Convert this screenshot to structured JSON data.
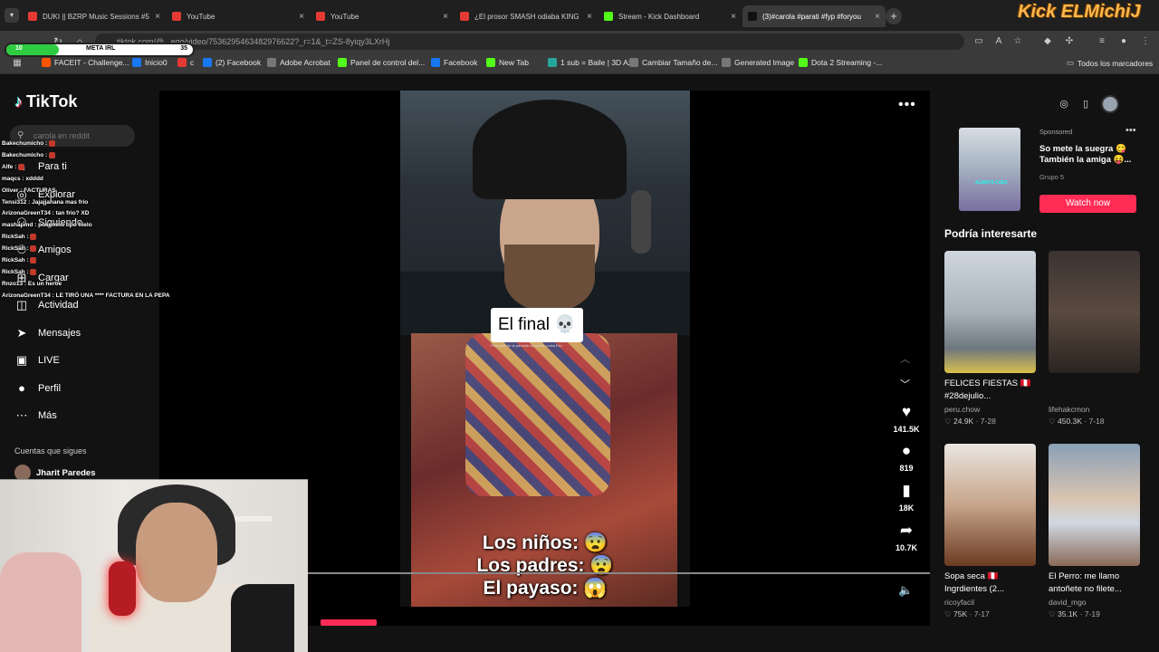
{
  "browser": {
    "tabs": [
      {
        "title": "DUKI || BZRP Music Sessions #5",
        "favicon_color": "#e53935",
        "active": false
      },
      {
        "title": "YouTube",
        "favicon_color": "#e53935",
        "active": false
      },
      {
        "title": "YouTube",
        "favicon_color": "#e53935",
        "active": false
      },
      {
        "title": "¿El prosor SMASH odiaba KING",
        "favicon_color": "#e53935",
        "active": false
      },
      {
        "title": "Stream - Kick Dashboard",
        "favicon_color": "#53fc18",
        "active": false
      },
      {
        "title": "(3)#carola #parati #fyp #foryou",
        "favicon_color": "#111111",
        "active": true
      }
    ],
    "close_glyph": "×",
    "new_tab_glyph": "+",
    "url": "tiktok.com/@...ego/video/7536295463482976622?_r=1&_t=ZS-8yiqy3LXrHj",
    "bookmarks": [
      {
        "label": "FACEIT - Challenge...",
        "color": "#ff5500"
      },
      {
        "label": "Inicio0",
        "color": "#1877f2"
      },
      {
        "label": "c",
        "color": "#e53935"
      },
      {
        "label": "(2) Facebook",
        "color": "#1877f2"
      },
      {
        "label": "Adobe Acrobat",
        "color": "#777777"
      },
      {
        "label": "Panel de control del...",
        "color": "#53fc18"
      },
      {
        "label": "Facebook",
        "color": "#1877f2"
      },
      {
        "label": "New Tab",
        "color": "#53fc18"
      },
      {
        "label": "1 sub = Baile | 3D Az...",
        "color": "#26a69a"
      },
      {
        "label": "Cambiar Tamaño de...",
        "color": "#777777"
      },
      {
        "label": "Generated Image",
        "color": "#777777"
      },
      {
        "label": "Dota 2 Streaming -...",
        "color": "#53fc18"
      }
    ],
    "all_bookmarks": "Todos los marcadores"
  },
  "overlay": {
    "brand": "Kick ELMichiJ",
    "meta_left": "10",
    "meta_label": "META IRL",
    "meta_right": "35",
    "meta_progress": 0.28
  },
  "tiktok": {
    "logo": "TikTok",
    "search_placeholder": "carola en reddit",
    "nav": [
      {
        "label": "Para ti",
        "icon": "home-icon"
      },
      {
        "label": "Explorar",
        "icon": "compass-icon"
      },
      {
        "label": "Siguiendo",
        "icon": "following-icon"
      },
      {
        "label": "Amigos",
        "icon": "friends-icon"
      },
      {
        "label": "Cargar",
        "icon": "upload-icon"
      },
      {
        "label": "Actividad",
        "icon": "activity-icon"
      },
      {
        "label": "Mensajes",
        "icon": "messages-icon"
      },
      {
        "label": "LIVE",
        "icon": "live-icon"
      },
      {
        "label": "Perfil",
        "icon": "profile-icon"
      },
      {
        "label": "Más",
        "icon": "more-icon"
      }
    ],
    "follows_title": "Cuentas que sigues",
    "follow1": "Jharit Paredes",
    "video": {
      "caption_top": "El final 💀",
      "small_text": "Para salir de la pantalla completa, pulsa Esc",
      "line1": "Los niños: 😨",
      "line2": "Los padres: 😨",
      "line3": "El payaso: 😱",
      "likes": "141.5K",
      "comments": "819",
      "saves": "18K",
      "shares": "10.7K",
      "playback_progress": 0.09
    },
    "ad": {
      "sponsored": "Sponsored",
      "title": "So mete la suegra 😋 También la amiga 😝...",
      "advertiser": "Grupo 5",
      "cta": "Watch now",
      "thumb_text": "ALWAYS CHEZ"
    },
    "suggest_title": "Podría interesarte",
    "cards": [
      {
        "title": "FELICES FIESTAS 🇵🇪 #28dejulio...",
        "author": "peru.chow",
        "likes": "24.9K",
        "date": "7-28"
      },
      {
        "title": "",
        "author": "lifehakcmon",
        "likes": "450.3K",
        "date": "7-18"
      },
      {
        "title": "Sopa seca 🇵🇪 Ingrdientes (2...",
        "author": "ricoyfacil",
        "likes": "75K",
        "date": "7-17"
      },
      {
        "title": "El Perro: me llamo antoñete no filete...",
        "author": "david_mgo",
        "likes": "35.1K",
        "date": "7-19"
      }
    ]
  },
  "chat": [
    {
      "user": "Bakechumicho",
      "msg": "",
      "emote": true
    },
    {
      "user": "Bakechumicho",
      "msg": "",
      "emote": true
    },
    {
      "user": "Alfe",
      "msg": "",
      "emote": true
    },
    {
      "user": "maqcs",
      "msg": "xdddd",
      "emote": false
    },
    {
      "user": "Oliver",
      "msg": "FACTURAS",
      "emote": false
    },
    {
      "user": "Tensi312",
      "msg": "Jajajjahana mas frio",
      "emote": false
    },
    {
      "user": "ArizonaGreenT34",
      "msg": "tan frio? XD",
      "emote": false
    },
    {
      "user": "mashapmd",
      "msg": "pokemno tipo hielo",
      "emote": false
    },
    {
      "user": "RickSah",
      "msg": "",
      "emote": true
    },
    {
      "user": "RickSah",
      "msg": "",
      "emote": true
    },
    {
      "user": "RickSah",
      "msg": "",
      "emote": true
    },
    {
      "user": "RickSah",
      "msg": "",
      "emote": true
    },
    {
      "user": "Rnzo13",
      "msg": "Es un heroe",
      "emote": false
    },
    {
      "user": "ArizonaGreenT34",
      "msg": "LE TIRÓ UNA **** FACTURA EN LA PEPA",
      "emote": false
    }
  ]
}
